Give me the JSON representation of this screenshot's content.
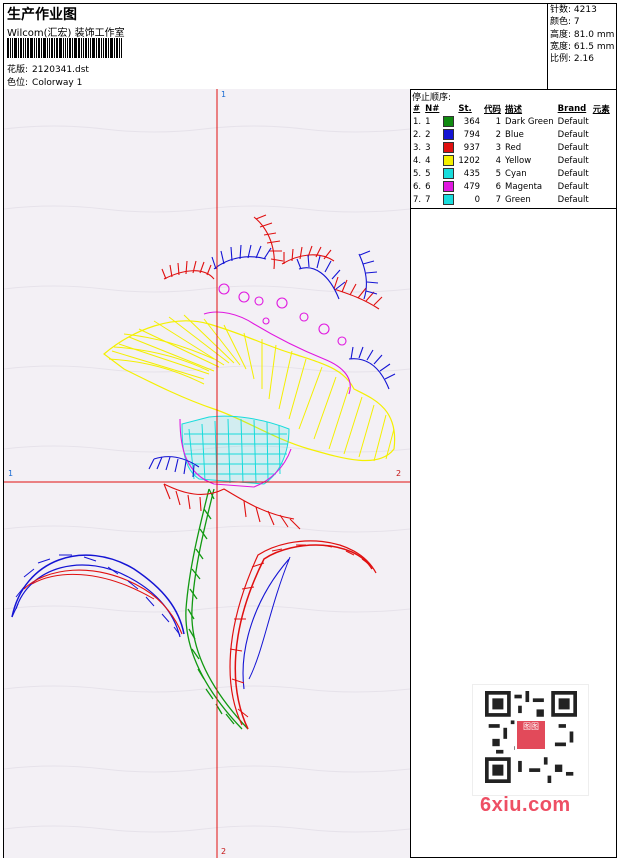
{
  "header": {
    "title": "生产作业图",
    "company": "Wilcom(汇宏) 装饰工作室",
    "pattern_label": "花版:",
    "pattern_value": "2120341.dst",
    "colorway_label": "色位:",
    "colorway_value": "Colorway 1"
  },
  "stats": {
    "stitches_label": "针数:",
    "stitches": "4213",
    "colors_label": "颜色:",
    "colors": "7",
    "height_label": "高度:",
    "height": "81.0 mm",
    "width_label": "宽度:",
    "width": "61.5 mm",
    "scale_label": "比例:",
    "scale": "2.16"
  },
  "sequence": {
    "title": "停止顺序:",
    "headers": [
      "#",
      "N#",
      "",
      "St.",
      "代码",
      "描述",
      "Brand",
      "元素"
    ],
    "rows": [
      {
        "idx": "1.",
        "n": "1",
        "color": "#108a10",
        "st": "364",
        "code": "1",
        "desc": "Dark Green",
        "brand": "Default"
      },
      {
        "idx": "2.",
        "n": "2",
        "color": "#1414d4",
        "st": "794",
        "code": "2",
        "desc": "Blue",
        "brand": "Default"
      },
      {
        "idx": "3.",
        "n": "3",
        "color": "#e01010",
        "st": "937",
        "code": "3",
        "desc": "Red",
        "brand": "Default"
      },
      {
        "idx": "4.",
        "n": "4",
        "color": "#f4f000",
        "st": "1202",
        "code": "4",
        "desc": "Yellow",
        "brand": "Default"
      },
      {
        "idx": "5.",
        "n": "5",
        "color": "#18dcdc",
        "st": "435",
        "code": "5",
        "desc": "Cyan",
        "brand": "Default"
      },
      {
        "idx": "6.",
        "n": "6",
        "color": "#e018e0",
        "st": "479",
        "code": "6",
        "desc": "Magenta",
        "brand": "Default"
      },
      {
        "idx": "7.",
        "n": "7",
        "color": "#18dcdc",
        "st": "0",
        "code": "7",
        "desc": "Green",
        "brand": "Default"
      }
    ]
  },
  "axes": {
    "top": "1",
    "bottom": "2",
    "left": "1",
    "right": "2"
  },
  "watermark": "6xiu.com",
  "qr_badge": "图图"
}
